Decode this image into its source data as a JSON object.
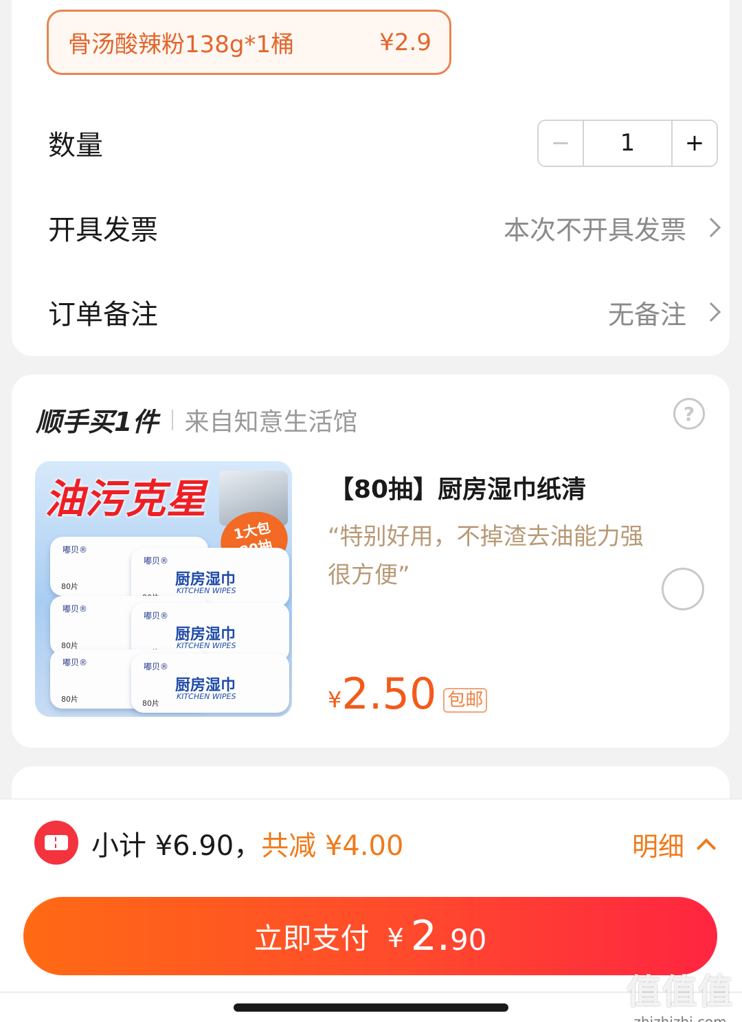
{
  "sku": {
    "name": "骨汤酸辣粉138g*1桶",
    "price": "¥2.9"
  },
  "quantity": {
    "label": "数量",
    "minus": "−",
    "value": "1",
    "plus": "+"
  },
  "invoice": {
    "label": "开具发票",
    "value": "本次不开具发票"
  },
  "remark": {
    "label": "订单备注",
    "value": "无备注"
  },
  "addon": {
    "title": "顺手买1件",
    "subtitle": "来自知意生活馆",
    "help": "?",
    "product": {
      "image": {
        "banner": "油污克星",
        "badge_line1": "1大包",
        "badge_line2": "80抽",
        "pack_name": "厨房湿巾",
        "pack_en": "KITCHEN WIPES",
        "pack_brand": "嘟贝®",
        "pack_count": "80片"
      },
      "title": "【80抽】厨房湿巾纸清",
      "quote": "“特别好用，不掉渣去油能力强很方便”",
      "currency": "¥",
      "price": "2.50",
      "shipping_tag": "包邮"
    }
  },
  "bottom": {
    "subtotal": "小计 ¥6.90，",
    "discount": "共减 ¥4.00",
    "detail": "明细",
    "pay_label": "立即支付",
    "pay_currency": "¥",
    "pay_int": "2.",
    "pay_dec": "90"
  },
  "watermark": {
    "logo": "值值值",
    "url": "zhizhizhi.com"
  },
  "colors": {
    "accent": "#f35a1a",
    "discount": "#f07a1a",
    "pay_start": "#ff6a14",
    "pay_end": "#ff2541"
  }
}
